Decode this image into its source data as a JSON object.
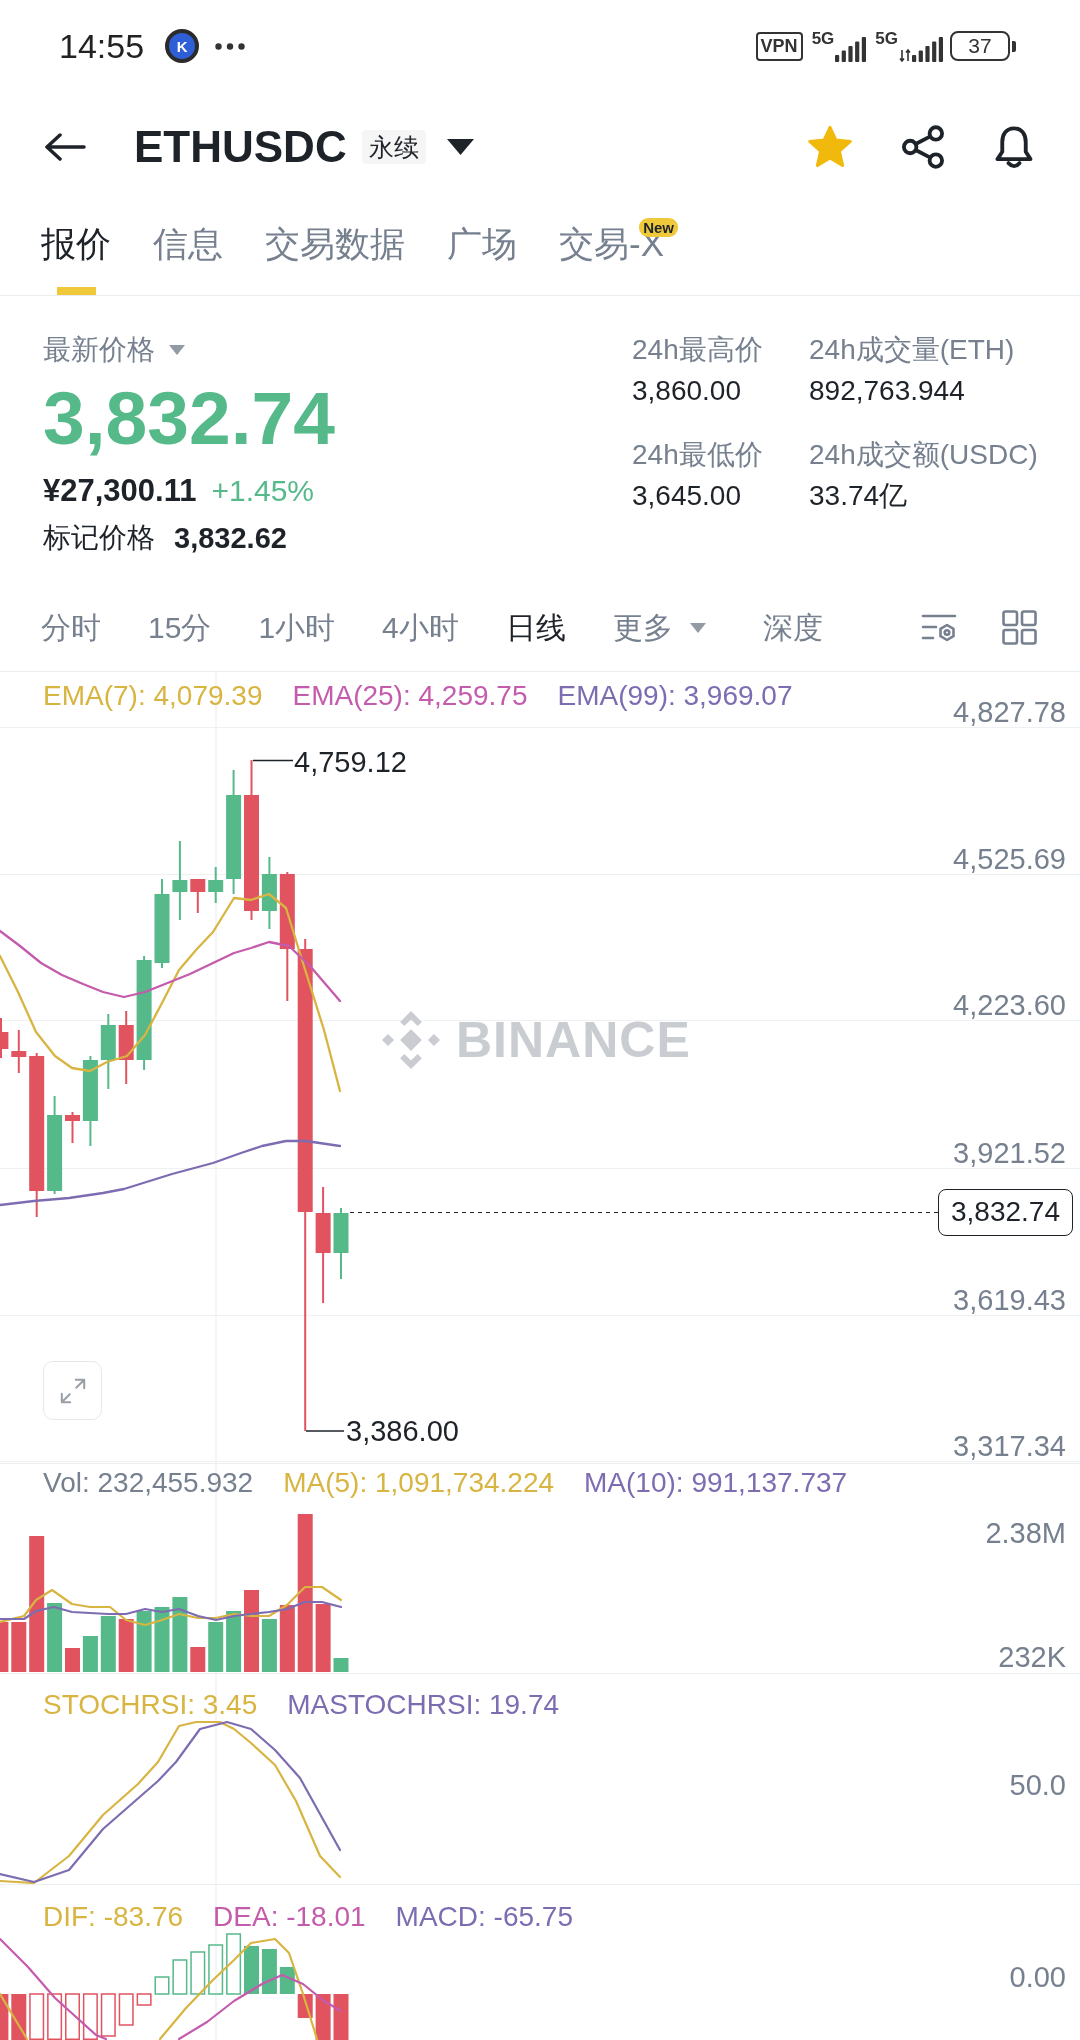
{
  "status_bar": {
    "time": "14:55",
    "notification_icon": {
      "letter": "K"
    },
    "vpn": "VPN",
    "signals": [
      {
        "network": "5G",
        "activity": false
      },
      {
        "network": "5G",
        "activity": true
      }
    ],
    "battery": "37"
  },
  "header": {
    "symbol": "ETHUSDC",
    "contract_tag": "永续",
    "favorite": true
  },
  "tabs": [
    {
      "label": "报价",
      "selected": true
    },
    {
      "label": "信息",
      "selected": false
    },
    {
      "label": "交易数据",
      "selected": false
    },
    {
      "label": "广场",
      "selected": false
    },
    {
      "label": "交易-X",
      "selected": false,
      "badge": "New"
    }
  ],
  "quote": {
    "label": "最新价格",
    "last_price": "3,832.74",
    "cny_price": "¥27,300.11",
    "change": "+1.45%",
    "mark_label": "标记价格",
    "mark_price": "3,832.62"
  },
  "stats": [
    {
      "label": "24h最高价",
      "value": "3,860.00"
    },
    {
      "label": "24h成交量(ETH)",
      "value": "892,763.944"
    },
    {
      "label": "24h最低价",
      "value": "3,645.00"
    },
    {
      "label": "24h成交额(USDC)",
      "value": "33.74亿"
    }
  ],
  "intervals": [
    {
      "label": "分时",
      "selected": false,
      "dropdown": false
    },
    {
      "label": "15分",
      "selected": false,
      "dropdown": false
    },
    {
      "label": "1小时",
      "selected": false,
      "dropdown": false
    },
    {
      "label": "4小时",
      "selected": false,
      "dropdown": false
    },
    {
      "label": "日线",
      "selected": true,
      "dropdown": false
    },
    {
      "label": "更多",
      "selected": false,
      "dropdown": true
    },
    {
      "label": "深度",
      "selected": false,
      "dropdown": false
    }
  ],
  "price_chart": {
    "legend": [
      {
        "text": "EMA(7): 4,079.39",
        "color": "#d8b441"
      },
      {
        "text": "EMA(25): 4,259.75",
        "color": "#c45bac"
      },
      {
        "text": "EMA(99): 3,969.07",
        "color": "#7d6cb1"
      }
    ],
    "axis_labels": [
      "4,827.78",
      "4,525.69",
      "4,223.60",
      "3,921.52",
      "3,619.43",
      "3,317.34"
    ],
    "high_label": "4,759.12",
    "low_label": "3,386.00",
    "last_price_tag": "3,832.74",
    "watermark": "BINANCE"
  },
  "volume_chart": {
    "legend": [
      {
        "text": "Vol: 232,455.932",
        "color": "#76808f"
      },
      {
        "text": "MA(5): 1,091,734.224",
        "color": "#d8b441"
      },
      {
        "text": "MA(10): 991,137.737",
        "color": "#7d6cb1"
      }
    ],
    "axis_labels": [
      "2.38M",
      "232K"
    ]
  },
  "stochrsi_chart": {
    "legend": [
      {
        "text": "STOCHRSI: 3.45",
        "color": "#d8b441"
      },
      {
        "text": "MASTOCHRSI: 19.74",
        "color": "#7d6cb1"
      }
    ],
    "axis_labels": [
      "50.0"
    ]
  },
  "macd_chart": {
    "legend": [
      {
        "text": "DIF: -83.76",
        "color": "#d8b441"
      },
      {
        "text": "DEA: -18.01",
        "color": "#c45bac"
      },
      {
        "text": "MACD: -65.75",
        "color": "#7d6cb1"
      }
    ],
    "axis_labels": [
      "0.00"
    ]
  }
}
